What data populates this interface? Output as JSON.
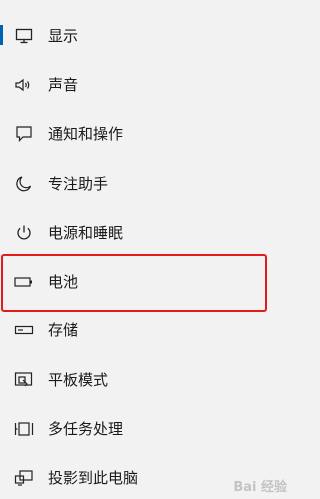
{
  "settings_nav": {
    "items": [
      {
        "label": "显示",
        "icon": "monitor-icon",
        "active": true
      },
      {
        "label": "声音",
        "icon": "speaker-icon"
      },
      {
        "label": "通知和操作",
        "icon": "notification-icon"
      },
      {
        "label": "专注助手",
        "icon": "moon-icon"
      },
      {
        "label": "电源和睡眠",
        "icon": "power-icon"
      },
      {
        "label": "电池",
        "icon": "battery-icon",
        "highlighted": true
      },
      {
        "label": "存储",
        "icon": "storage-icon"
      },
      {
        "label": "平板模式",
        "icon": "tablet-mode-icon"
      },
      {
        "label": "多任务处理",
        "icon": "multitasking-icon"
      },
      {
        "label": "投影到此电脑",
        "icon": "project-to-pc-icon"
      }
    ]
  },
  "colors": {
    "accent": "#0063b1",
    "highlight_border": "#e21b1b",
    "background": "#f2f2f2",
    "text": "#1a1a1a"
  },
  "watermark": {
    "text": "Bai 经验"
  }
}
